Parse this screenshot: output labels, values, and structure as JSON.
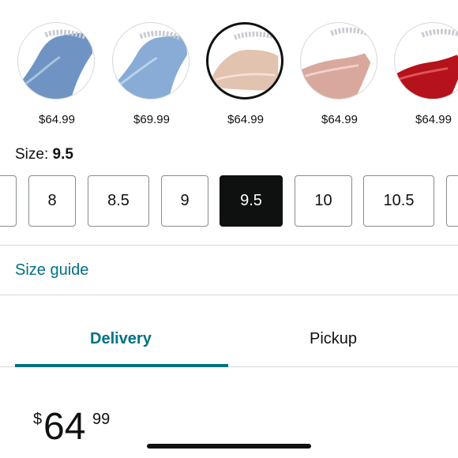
{
  "colors": {
    "accent_teal": "#007185",
    "text": "#0f1111",
    "border": "#888c8c"
  },
  "swatches": [
    {
      "price": "$64.99",
      "icon": "shoe-denim-blue"
    },
    {
      "price": "$69.99",
      "icon": "shoe-light-denim"
    },
    {
      "price": "$64.99",
      "icon": "shoe-nude-patent",
      "selected": true
    },
    {
      "price": "$64.99",
      "icon": "shoe-pink-patent"
    },
    {
      "price": "$64.99",
      "icon": "shoe-red-patent"
    }
  ],
  "size": {
    "label": "Size:",
    "selected_value": "9.5",
    "options": [
      "8",
      "8.5",
      "9",
      "9.5",
      "10",
      "10.5"
    ]
  },
  "size_guide": "Size guide",
  "tabs": {
    "delivery": "Delivery",
    "pickup": "Pickup",
    "active": "Delivery"
  },
  "price": {
    "symbol": "$",
    "whole": "64",
    "fraction": "99"
  }
}
